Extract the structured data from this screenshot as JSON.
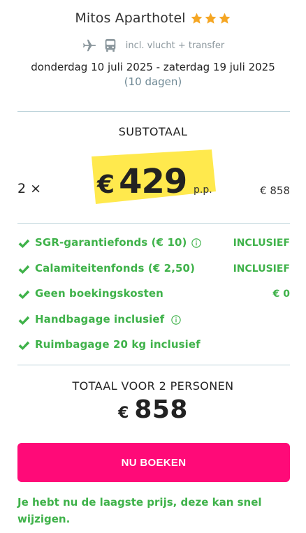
{
  "hotel": {
    "name": "Mitos Aparthotel",
    "stars": 3,
    "star_color": "#f5a623"
  },
  "transport": {
    "icons": [
      "airplane-icon",
      "bus-icon"
    ],
    "text": "incl. vlucht + transfer"
  },
  "trip": {
    "dates": "donderdag 10 juli 2025 - zaterdag 19 juli 2025",
    "duration": "(10 dagen)"
  },
  "subtotal": {
    "title": "SUBTOTAAL",
    "quantity": "2 ×",
    "currency": "€",
    "price": "429",
    "per_person": "p.p.",
    "amount": "€ 858",
    "highlight_color": "#ffe94d"
  },
  "features": [
    {
      "label": "SGR-garantiefonds  (€ 10)",
      "info": true,
      "status": "INCLUSIEF"
    },
    {
      "label": "Calamiteitenfonds  (€ 2,50)",
      "info": false,
      "status": "INCLUSIEF"
    },
    {
      "label": "Geen boekingskosten",
      "info": false,
      "status": "€ 0"
    },
    {
      "label": "Handbagage inclusief",
      "info": true,
      "status": ""
    },
    {
      "label": "Ruimbagage 20 kg inclusief",
      "info": false,
      "status": ""
    }
  ],
  "total": {
    "title": "TOTAAL VOOR 2 PERSONEN",
    "currency": "€",
    "amount": "858"
  },
  "book_button": {
    "label": "NU BOEKEN",
    "color": "#ff0a78"
  },
  "note": "Je hebt nu de laagste prijs, deze kan snel wijzigen.",
  "colors": {
    "green": "#3fb24a",
    "divider": "#bcd3da"
  }
}
